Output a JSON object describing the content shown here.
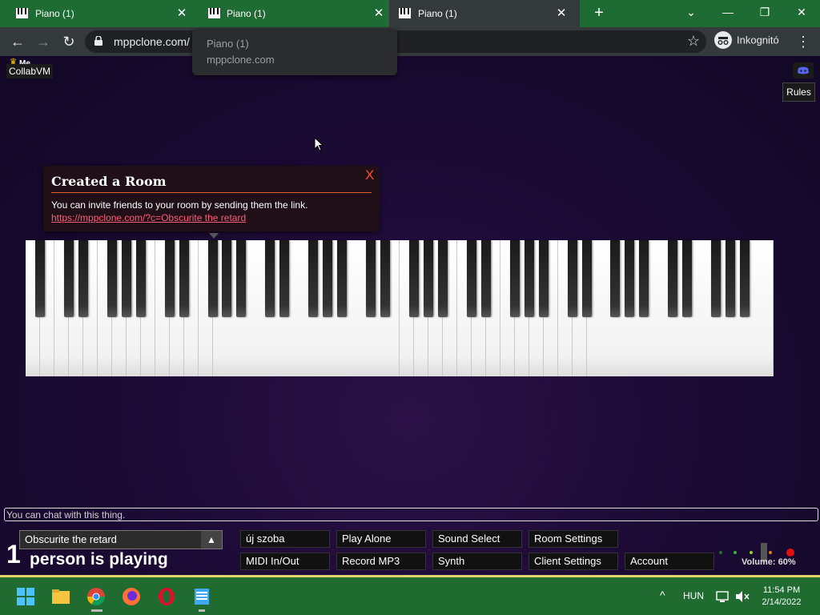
{
  "browser": {
    "tabs": [
      {
        "label": "Piano (1)",
        "active": false
      },
      {
        "label": "Piano (1)",
        "active": false
      },
      {
        "label": "Piano (1)",
        "active": true
      }
    ],
    "new_tab": "+",
    "window_controls": {
      "chevron": "⌄",
      "minimize": "—",
      "restore": "❐",
      "close": "✕"
    },
    "url": "mppclone.com/",
    "profile_label": "Inkognitó",
    "tooltip": {
      "title": "Piano (1)",
      "host": "mppclone.com"
    }
  },
  "page": {
    "crown_icon": "crown-icon",
    "me_label": "Me",
    "username": "CollabVM",
    "rules_label": "Rules",
    "notification": {
      "title": "Created a Room",
      "close": "X",
      "body": "You can invite friends to your room by sending them the link.",
      "link": "https://mppclone.com/?c=Obscurite the retard"
    },
    "chat_placeholder": "You can chat with this thing.",
    "room": {
      "name": "Obscurite the retard",
      "arrow": "▲",
      "count": "1",
      "playing_text": "person is playing"
    },
    "controls": {
      "new_room": "új szoba",
      "play_alone": "Play Alone",
      "sound_select": "Sound Select",
      "room_settings": "Room Settings",
      "midi": "MIDI In/Out",
      "record": "Record MP3",
      "synth": "Synth",
      "client_settings": "Client Settings",
      "account": "Account"
    },
    "volume_label": "Volume: 60%",
    "volume_value": 0.6
  },
  "taskbar": {
    "language": "HUN",
    "time": "11:54 PM",
    "date": "2/14/2022"
  },
  "colors": {
    "tabbar": "#1e6b33",
    "toolbar": "#34393b",
    "notify_accent": "#e0602a",
    "link": "#ff5c7a",
    "close": "#ff4a3a"
  }
}
